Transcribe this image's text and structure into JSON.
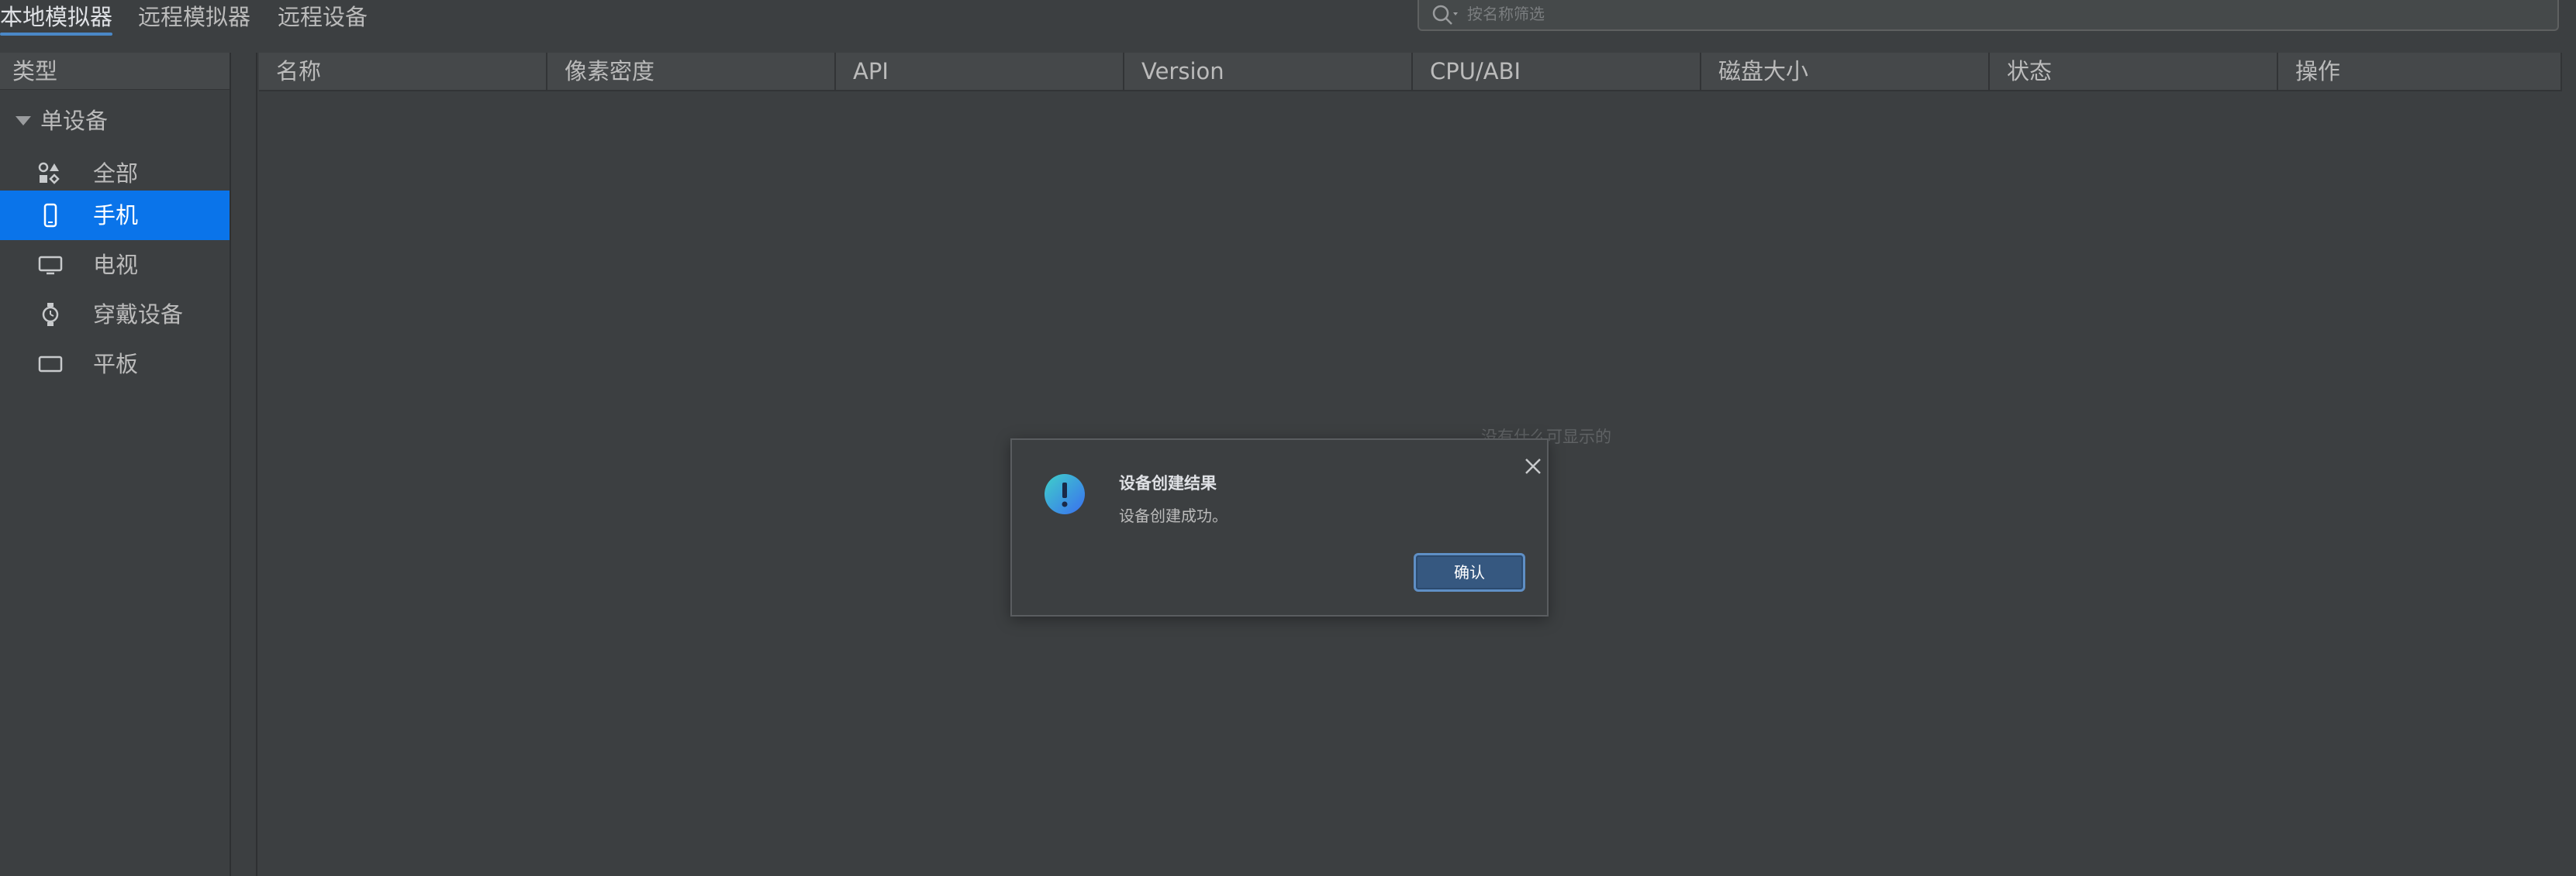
{
  "tabs": [
    {
      "label": "本地模拟器",
      "active": true
    },
    {
      "label": "远程模拟器",
      "active": false
    },
    {
      "label": "远程设备",
      "active": false
    }
  ],
  "search": {
    "placeholder": "按名称筛选"
  },
  "sidebar": {
    "header": "类型",
    "group": {
      "label": "单设备",
      "expanded": true
    },
    "items": [
      {
        "label": "全部",
        "icon": "grid-shapes-icon"
      },
      {
        "label": "手机",
        "icon": "phone-icon",
        "selected": true
      },
      {
        "label": "电视",
        "icon": "tv-icon"
      },
      {
        "label": "穿戴设备",
        "icon": "watch-icon"
      },
      {
        "label": "平板",
        "icon": "tablet-icon"
      }
    ]
  },
  "table": {
    "columns": [
      "名称",
      "像素密度",
      "API",
      "Version",
      "CPU/ABI",
      "磁盘大小",
      "状态",
      "操作"
    ],
    "empty_text": "没有什么可显示的"
  },
  "dialog": {
    "title": "设备创建结果",
    "message": "设备创建成功。",
    "ok_label": "确认"
  },
  "colors": {
    "background": "#3c3f41",
    "selected": "#0a74ea",
    "tab_underline": "#4a88c7",
    "button": "#365880"
  }
}
